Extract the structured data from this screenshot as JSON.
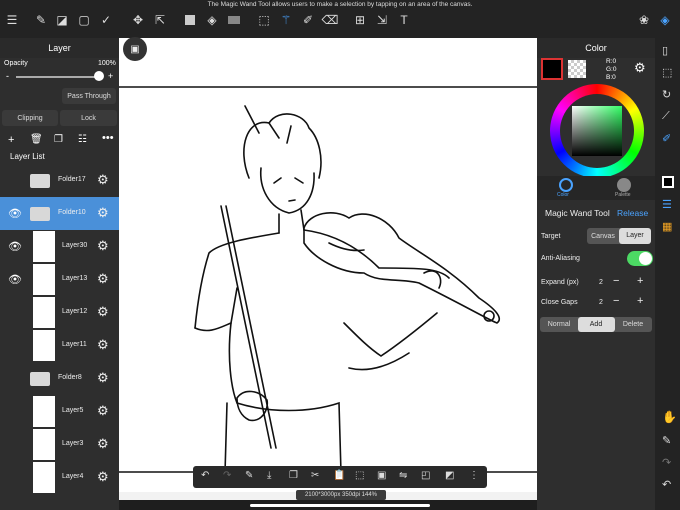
{
  "tip": "The Magic Wand Tool allows users to make a selection by tapping on an area of the canvas.",
  "layer_panel": {
    "title": "Layer",
    "opacity_label": "Opacity",
    "opacity_value": "100%",
    "minus": "-",
    "plus": "+",
    "blend_mode": "Pass Through",
    "clipping": "Clipping",
    "lock": "Lock",
    "list_title": "Layer List",
    "layers": [
      {
        "name": "Folder17",
        "kind": "folder",
        "eye": false,
        "selected": false
      },
      {
        "name": "Folder10",
        "kind": "folder",
        "eye": true,
        "selected": true
      },
      {
        "name": "Layer30",
        "kind": "layer",
        "eye": true,
        "selected": false
      },
      {
        "name": "Layer13",
        "kind": "layer",
        "eye": true,
        "selected": false
      },
      {
        "name": "Layer12",
        "kind": "layer",
        "eye": false,
        "selected": false
      },
      {
        "name": "Layer11",
        "kind": "layer",
        "eye": false,
        "selected": false
      },
      {
        "name": "Folder8",
        "kind": "folder",
        "eye": false,
        "selected": false
      },
      {
        "name": "Layer5",
        "kind": "layer",
        "eye": false,
        "selected": false
      },
      {
        "name": "Layer3",
        "kind": "layer",
        "eye": false,
        "selected": false
      },
      {
        "name": "Layer4",
        "kind": "layer",
        "eye": false,
        "selected": false
      }
    ]
  },
  "color_panel": {
    "title": "Color",
    "r": "R:0",
    "g": "G:0",
    "b": "B:0",
    "tab_color": "Color",
    "tab_palette": "Palette"
  },
  "magic_wand": {
    "title": "Magic Wand Tool",
    "release": "Release",
    "target_label": "Target",
    "target_canvas": "Canvas",
    "target_layer": "Layer",
    "antialias_label": "Anti-Aliasing",
    "expand_label": "Expand (px)",
    "expand_value": "2",
    "gaps_label": "Close Gaps",
    "gaps_value": "2",
    "mode_normal": "Normal",
    "mode_add": "Add",
    "mode_delete": "Delete"
  },
  "status": "2100*3000px 350dpi 144%",
  "colors": {
    "accent": "#4aa3ff",
    "selected_layer": "#4a90d9",
    "toggle_on": "#4cd964"
  }
}
